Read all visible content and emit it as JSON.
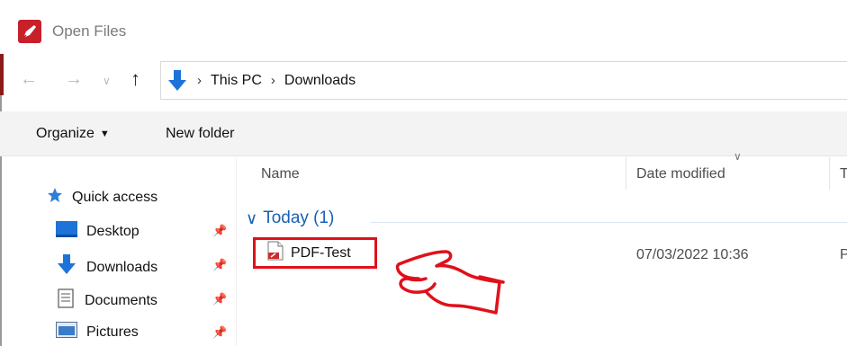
{
  "window": {
    "title": "Open Files"
  },
  "navigation": {
    "back_icon": "arrow-left-icon",
    "forward_icon": "arrow-right-icon",
    "recent_icon": "chevron-down-icon",
    "up_icon": "arrow-up-icon"
  },
  "address": {
    "icon": "download-arrow-icon",
    "crumbs": [
      "This PC",
      "Downloads"
    ],
    "separator": "›"
  },
  "commandbar": {
    "organize_label": "Organize",
    "new_folder_label": "New folder"
  },
  "sidebar": {
    "quick_access_label": "Quick access",
    "items": [
      {
        "label": "Desktop",
        "icon": "desktop-icon",
        "pinned": true
      },
      {
        "label": "Downloads",
        "icon": "download-arrow-icon",
        "pinned": true
      },
      {
        "label": "Documents",
        "icon": "document-icon",
        "pinned": true
      },
      {
        "label": "Pictures",
        "icon": "pictures-icon",
        "pinned": true
      }
    ]
  },
  "filelist": {
    "columns": {
      "name": "Name",
      "date": "Date modified",
      "type": "T"
    },
    "groups": [
      {
        "label": "Today (1)",
        "files": [
          {
            "name": "PDF-Test",
            "date": "07/03/2022 10:36",
            "type": "P",
            "icon": "pdf-file-icon"
          }
        ]
      }
    ]
  },
  "colors": {
    "accent": "#1a5fb4",
    "highlight_border": "#e0101a",
    "app_icon_bg": "#c8202a"
  }
}
